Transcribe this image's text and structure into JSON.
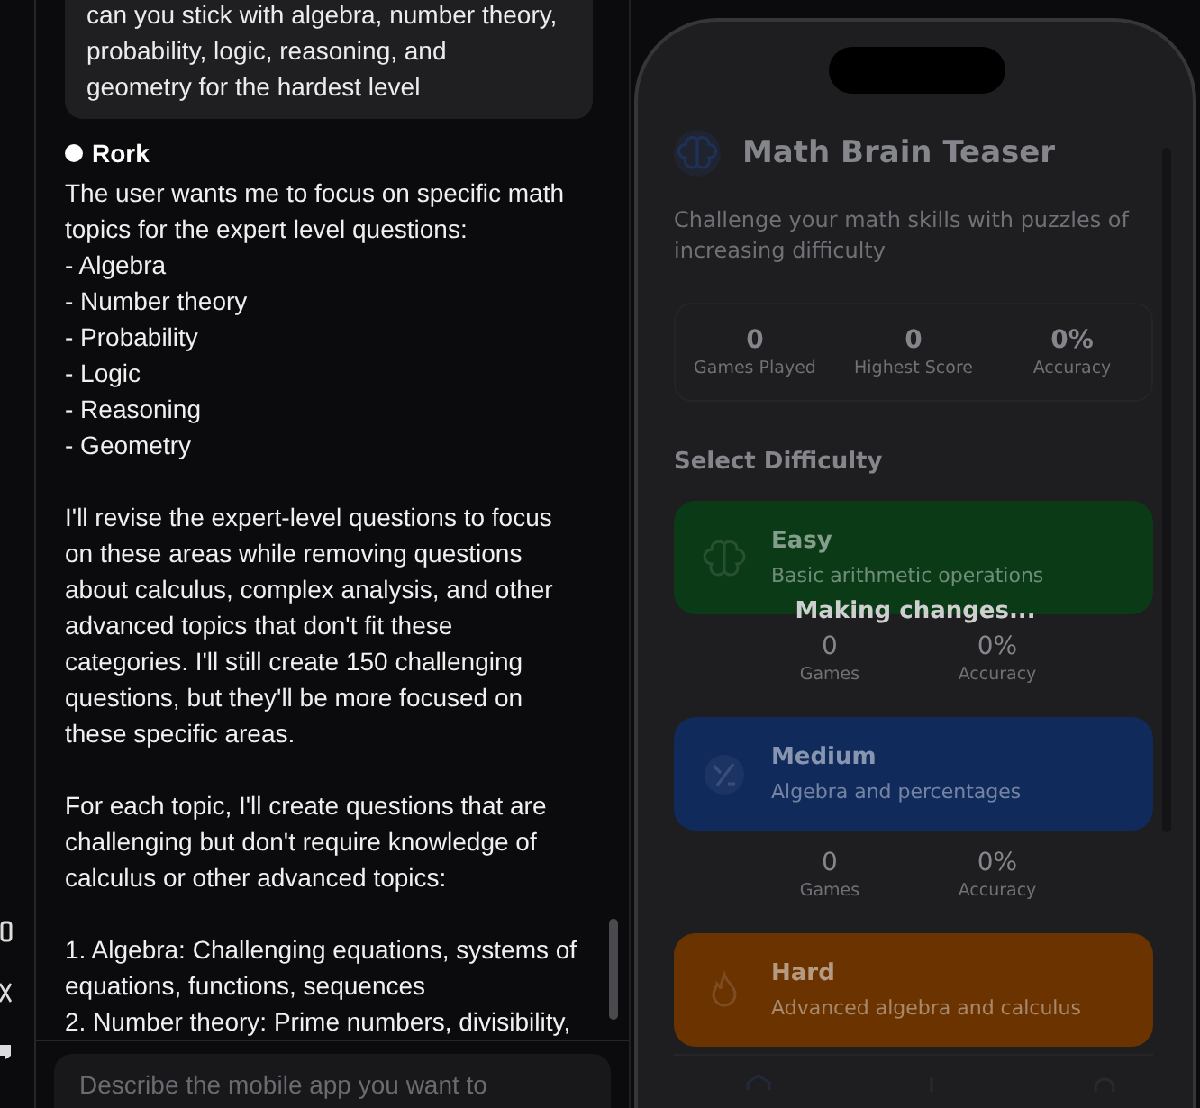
{
  "chat": {
    "user_message": "can you stick with algebra, number theory,\nprobability, logic, reasoning, and\ngeometry for the hardest level",
    "assistant": {
      "author": "Rork",
      "paragraphs": [
        "The user wants me to focus on specific math\ntopics for the expert level questions:\n- Algebra\n- Number theory\n- Probability\n- Logic\n- Reasoning\n- Geometry",
        "I'll revise the expert-level questions to focus\non these areas while removing questions\nabout calculus, complex analysis, and other\nadvanced topics that don't fit these\ncategories. I'll still create 150 challenging\nquestions, but they'll be more focused on\nthese specific areas.",
        "For each topic, I'll create questions that are\nchallenging but don't require knowledge of\ncalculus or other advanced topics:",
        "1. Algebra: Challenging equations, systems of\nequations, functions, sequences\n2. Number theory: Prime numbers, divisibility,"
      ]
    }
  },
  "input": {
    "placeholder": "Describe the mobile app you want to"
  },
  "preview": {
    "app_title": "Math Brain Teaser",
    "subtitle": "Challenge your math skills with puzzles of increasing difficulty",
    "stats": [
      {
        "value": "0",
        "label": "Games Played"
      },
      {
        "value": "0",
        "label": "Highest Score"
      },
      {
        "value": "0%",
        "label": "Accuracy"
      }
    ],
    "section_title": "Select Difficulty",
    "levels": [
      {
        "kind": "brain",
        "name": "Easy",
        "description": "Basic arithmetic operations",
        "color": "#0b3a17",
        "stats": [
          {
            "value": "0",
            "label": "Games"
          },
          {
            "value": "0%",
            "label": "Accuracy"
          }
        ]
      },
      {
        "kind": "fraction",
        "name": "Medium",
        "description": "Algebra and percentages",
        "color": "#102a5c",
        "stats": [
          {
            "value": "0",
            "label": "Games"
          },
          {
            "value": "0%",
            "label": "Accuracy"
          }
        ]
      },
      {
        "kind": "flame",
        "name": "Hard",
        "description": "Advanced algebra and calculus",
        "color": "#6a3300"
      }
    ],
    "status": "Making changes..."
  }
}
